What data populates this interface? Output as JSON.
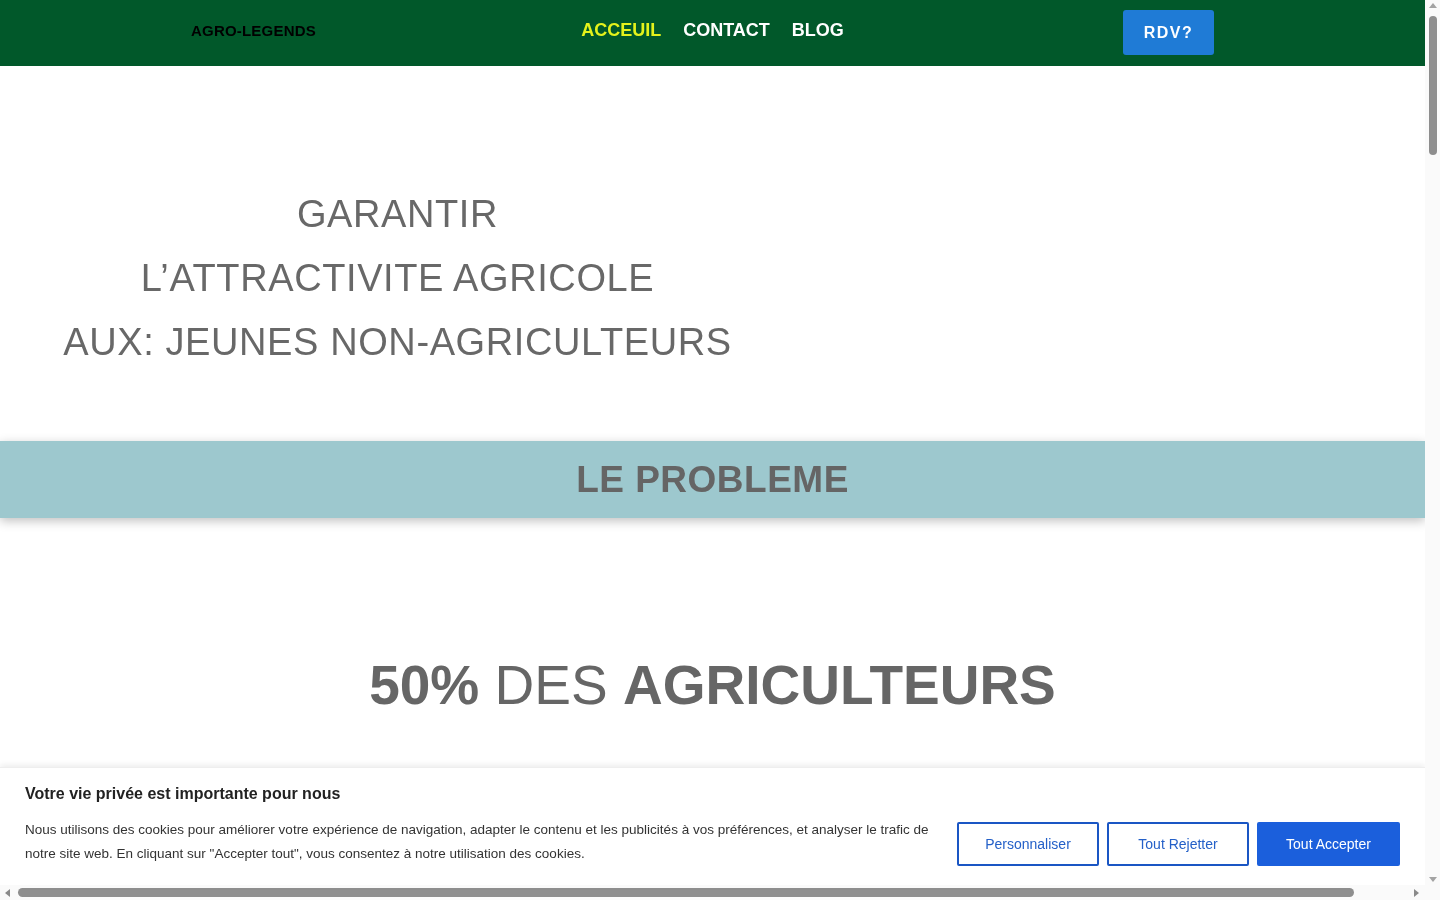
{
  "header": {
    "logo": "AGRO-LEGENDS",
    "nav": [
      {
        "label": "ACCEUIL",
        "selected": true
      },
      {
        "label": "CONTACT",
        "selected": false
      },
      {
        "label": "BLOG",
        "selected": false
      }
    ],
    "cta_button": "RDV?"
  },
  "hero": {
    "title_lines": [
      "GARANTIR",
      "L’ATTRACTIVITE AGRICOLE",
      "AUX: JEUNES NON-AGRICULTEURS"
    ]
  },
  "section_banner": {
    "title": "LE PROBLEME"
  },
  "statistic": {
    "headline": "**50%** DES **AGRICULTEURS**"
  },
  "cookie_banner": {
    "title": "Votre vie privée est importante pour nous",
    "text": "Nous utilisons des cookies pour améliorer votre expérience de navigation, adapter le contenu et les publicités à vos préférences, et analyser le trafic de notre site web. En cliquant sur \"Accepter tout\", vous consentez à notre utilisation des cookies.",
    "buttons": [
      {
        "label": "Personnaliser",
        "kind": "outline"
      },
      {
        "label": "Tout Rejetter",
        "kind": "outline"
      },
      {
        "label": "Tout Accepter",
        "kind": "primary"
      }
    ]
  }
}
